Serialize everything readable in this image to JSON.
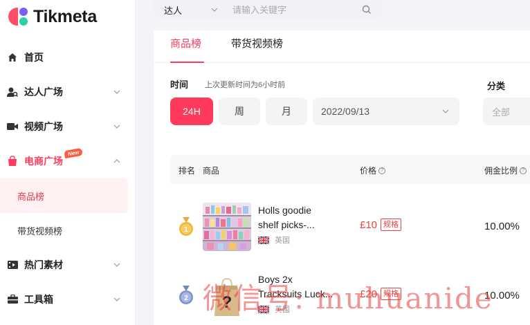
{
  "app": {
    "brand": "Tikmeta",
    "accent_color": "#ff3a5c"
  },
  "sidebar": {
    "items": [
      {
        "label": "首页",
        "icon": "home-icon"
      },
      {
        "label": "达人广场",
        "icon": "user-search-icon"
      },
      {
        "label": "视频广场",
        "icon": "video-icon"
      },
      {
        "label": "电商广场",
        "icon": "shopping-bag-icon",
        "badge": "New"
      },
      {
        "label": "热门素材",
        "icon": "film-icon"
      },
      {
        "label": "工具箱",
        "icon": "toolbox-icon"
      }
    ],
    "sub_items": [
      {
        "label": "商品榜"
      },
      {
        "label": "带货视频榜"
      }
    ]
  },
  "search": {
    "type_label": "达人",
    "placeholder": "请输入关键字"
  },
  "tabs": [
    {
      "label": "商品榜"
    },
    {
      "label": "带货视频榜"
    }
  ],
  "filters": {
    "time_label": "时间",
    "update_note": "上次更新时间为6小时前",
    "periods": [
      "24H",
      "周",
      "月"
    ],
    "selected_period": "24H",
    "date": "2022/09/13",
    "category_label": "分类",
    "category_value": "全部"
  },
  "table": {
    "headers": {
      "rank": "排名",
      "product": "商品",
      "price": "价格",
      "commission": "佣金比例"
    },
    "rows": [
      {
        "rank": 1,
        "name": "Holls goodie shelf picks-...",
        "country": "英国",
        "price": "£10",
        "price_tag": "规格",
        "commission": "10.00%"
      },
      {
        "rank": 2,
        "name": "Boys 2x Tracksuits Luck...",
        "country": "英国",
        "price": "£20",
        "price_tag": "规格",
        "commission": "10.00%"
      }
    ]
  },
  "watermark": "微信号: muhuanide"
}
